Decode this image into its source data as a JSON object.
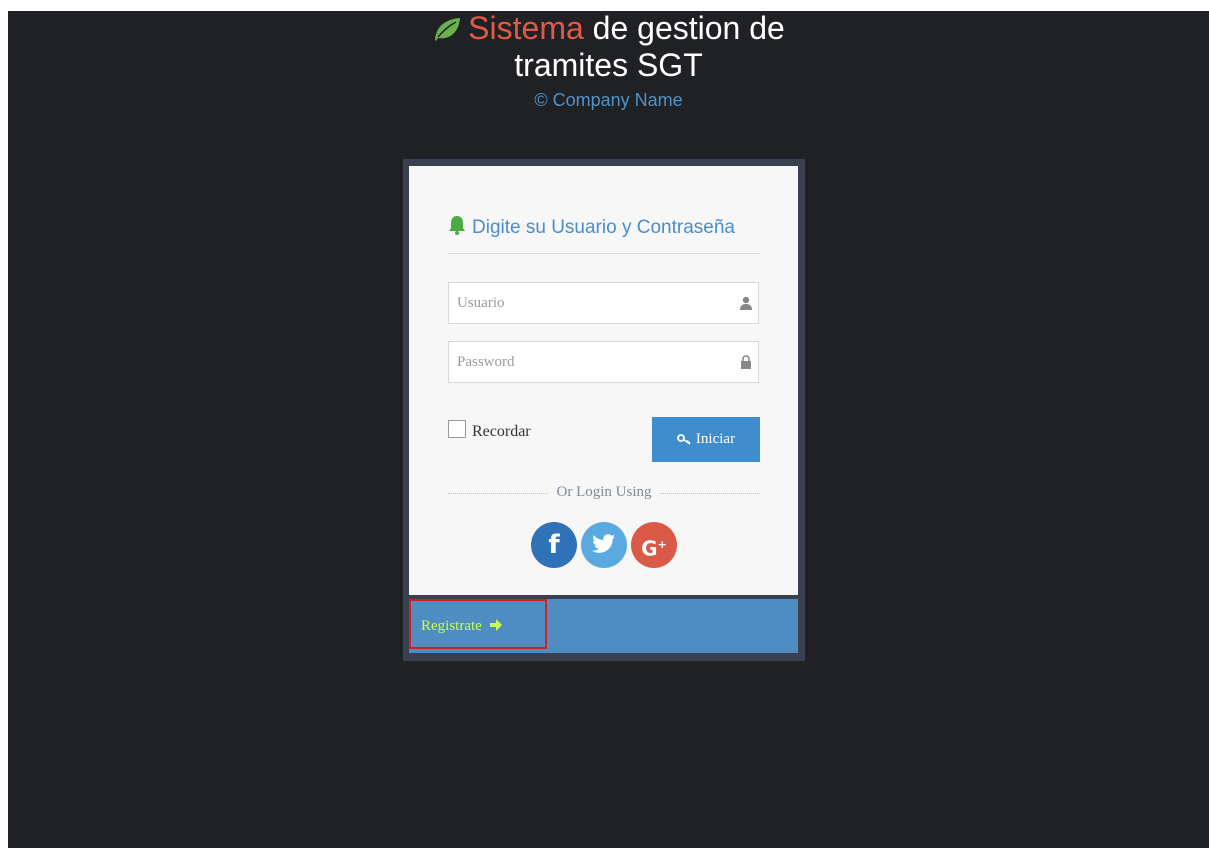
{
  "header": {
    "title_accent": "Sistema",
    "title_rest": " de gestion de tramites SGT",
    "company": "© Company Name",
    "leaf_icon": "leaf-icon"
  },
  "login": {
    "heading": "Digite su Usuario y Contraseña",
    "heading_icon": "bell-icon",
    "username_placeholder": "Usuario",
    "username_value": "",
    "password_placeholder": "Password",
    "password_value": "",
    "remember_label": "Recordar",
    "remember_checked": false,
    "submit_label": "Iniciar",
    "divider_text": "Or Login Using",
    "social": [
      "facebook-icon",
      "twitter-icon",
      "google-plus-icon"
    ]
  },
  "footer": {
    "register_label": "Registrate"
  },
  "colors": {
    "background": "#1f2125",
    "accent_red": "#e25a45",
    "accent_blue": "#4f92c8",
    "leaf_green": "#6ab04c",
    "button_blue": "#3f8dcc",
    "footer_blue": "#4f8cc2",
    "register_green": "#c7ff53",
    "highlight_red": "#d61e26"
  }
}
